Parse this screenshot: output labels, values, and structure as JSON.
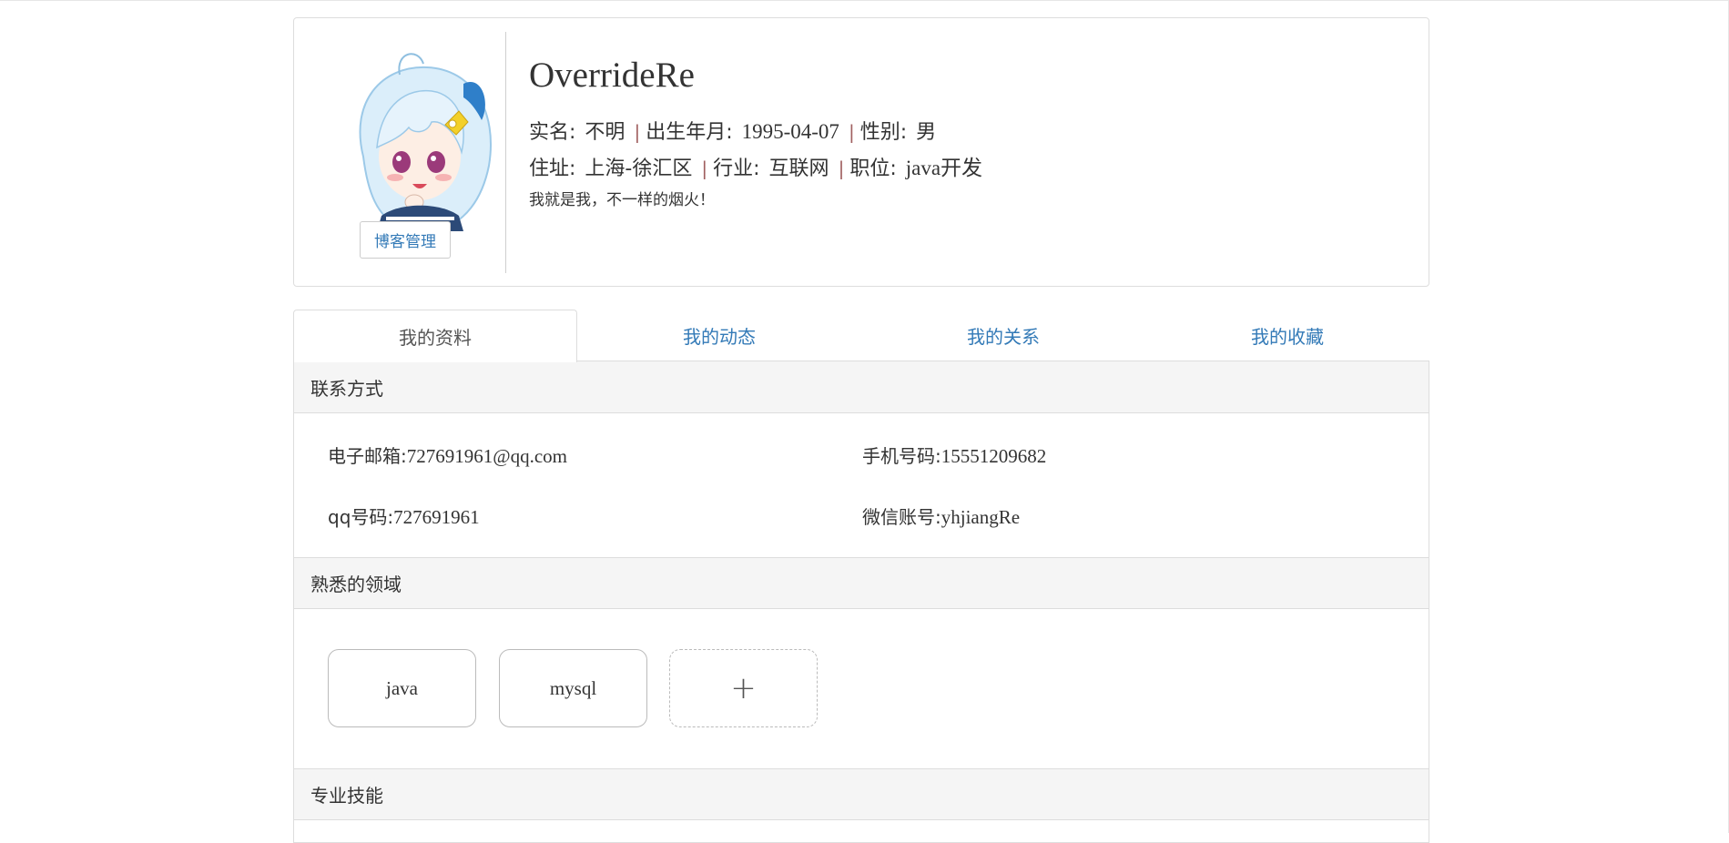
{
  "profile": {
    "username": "OverrideRe",
    "blog_button": "博客管理",
    "real_name_label": "实名:",
    "real_name": "不明",
    "birth_label": "出生年月:",
    "birth": "1995-04-07",
    "gender_label": "性别:",
    "gender": "男",
    "address_label": "住址:",
    "address": "上海-徐汇区",
    "industry_label": "行业:",
    "industry": "互联网",
    "position_label": "职位:",
    "position": "java开发",
    "separator": "|",
    "bio": "我就是我，不一样的烟火！"
  },
  "tabs": [
    "我的资料",
    "我的动态",
    "我的关系",
    "我的收藏"
  ],
  "sections": {
    "contact_title": "联系方式",
    "skills_title": "熟悉的领域",
    "pro_title": "专业技能"
  },
  "contact": {
    "email_label": "电子邮箱:",
    "email": "727691961@qq.com",
    "phone_label": "手机号码:",
    "phone": "15551209682",
    "qq_label": "qq号码:",
    "qq": "727691961",
    "wechat_label": "微信账号:",
    "wechat": "yhjiangRe"
  },
  "skills": [
    "java",
    "mysql"
  ],
  "add_skill_symbol": "+",
  "colors": {
    "link": "#337ab7",
    "section_bg": "#f5f5f5",
    "border": "#dddddd"
  }
}
